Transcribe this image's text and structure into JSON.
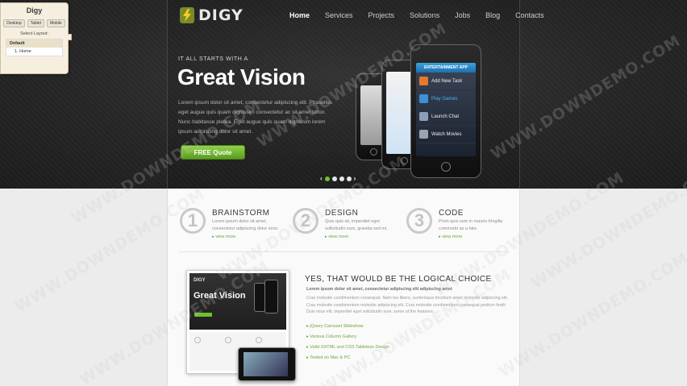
{
  "panel": {
    "title": "Digy",
    "buttons": [
      "Desktop",
      "Tablet",
      "Mobile"
    ],
    "select_label": "Select Layout:",
    "list_header": "Default",
    "list_item": "1. Home"
  },
  "logo_text": "DIGY",
  "nav": [
    "Home",
    "Services",
    "Projects",
    "Solutions",
    "Jobs",
    "Blog",
    "Contacts"
  ],
  "hero": {
    "tagline": "IT ALL STARTS WITH A",
    "title": "Great Vision",
    "text": "Lorem ipsum dolor sit amet, consectetur adipiscing elit. Phasellus eget augue quis quam dignissim consectetur ac sit amet tortor. Nunc habitasse platea. Eget augue quis quam dignissim lorem ipsum adipiscing dolor sit amet.",
    "button": "FREE Quote",
    "app_header": "ENTERTAINMENT APP",
    "app_items": [
      "Add New Task",
      "Play Games",
      "Launch Chat",
      "Watch Movies"
    ]
  },
  "features": [
    {
      "num": "1",
      "title": "BRAINSTORM",
      "text": "Lorem ipsum dolor sit amet, consectetur adipiscing dolor error.",
      "more": "view more"
    },
    {
      "num": "2",
      "title": "DESIGN",
      "text": "Quis quis sit, imperdiet eget sollicitudin sum, gravida sed mi.",
      "more": "view more"
    },
    {
      "num": "3",
      "title": "CODE",
      "text": "Proin quis sem in mauris fringilla commodo as a fate.",
      "more": "view more"
    }
  ],
  "preview": {
    "t1": "DIGY",
    "t2": "Great Vision"
  },
  "why": {
    "heading": "YES, THAT WOULD BE THE LOGICAL CHOICE",
    "lead": "Lorem ipsum dolor sit amet, consectetur adipiscing elit adipiscing amet",
    "body": "Cras molestie condimentum consequat. Nam leo libero, scelerisque tincidunt amet, molestie adipiscing elit. Cras molestie condimentum molestie adipiscing elit. Cras molestie condimentum consequat pretium ferdii Duis risus elit, imperdiet eget sollicitudin sum, some of the features:",
    "list": [
      "jQuery Carousel Slideshow",
      "Various Column Gallery",
      "Valid XHTML and CSS Tableless Design",
      "Tested on Mac & PC"
    ]
  },
  "watermark": "WWW.DOWNDEMO.COM"
}
